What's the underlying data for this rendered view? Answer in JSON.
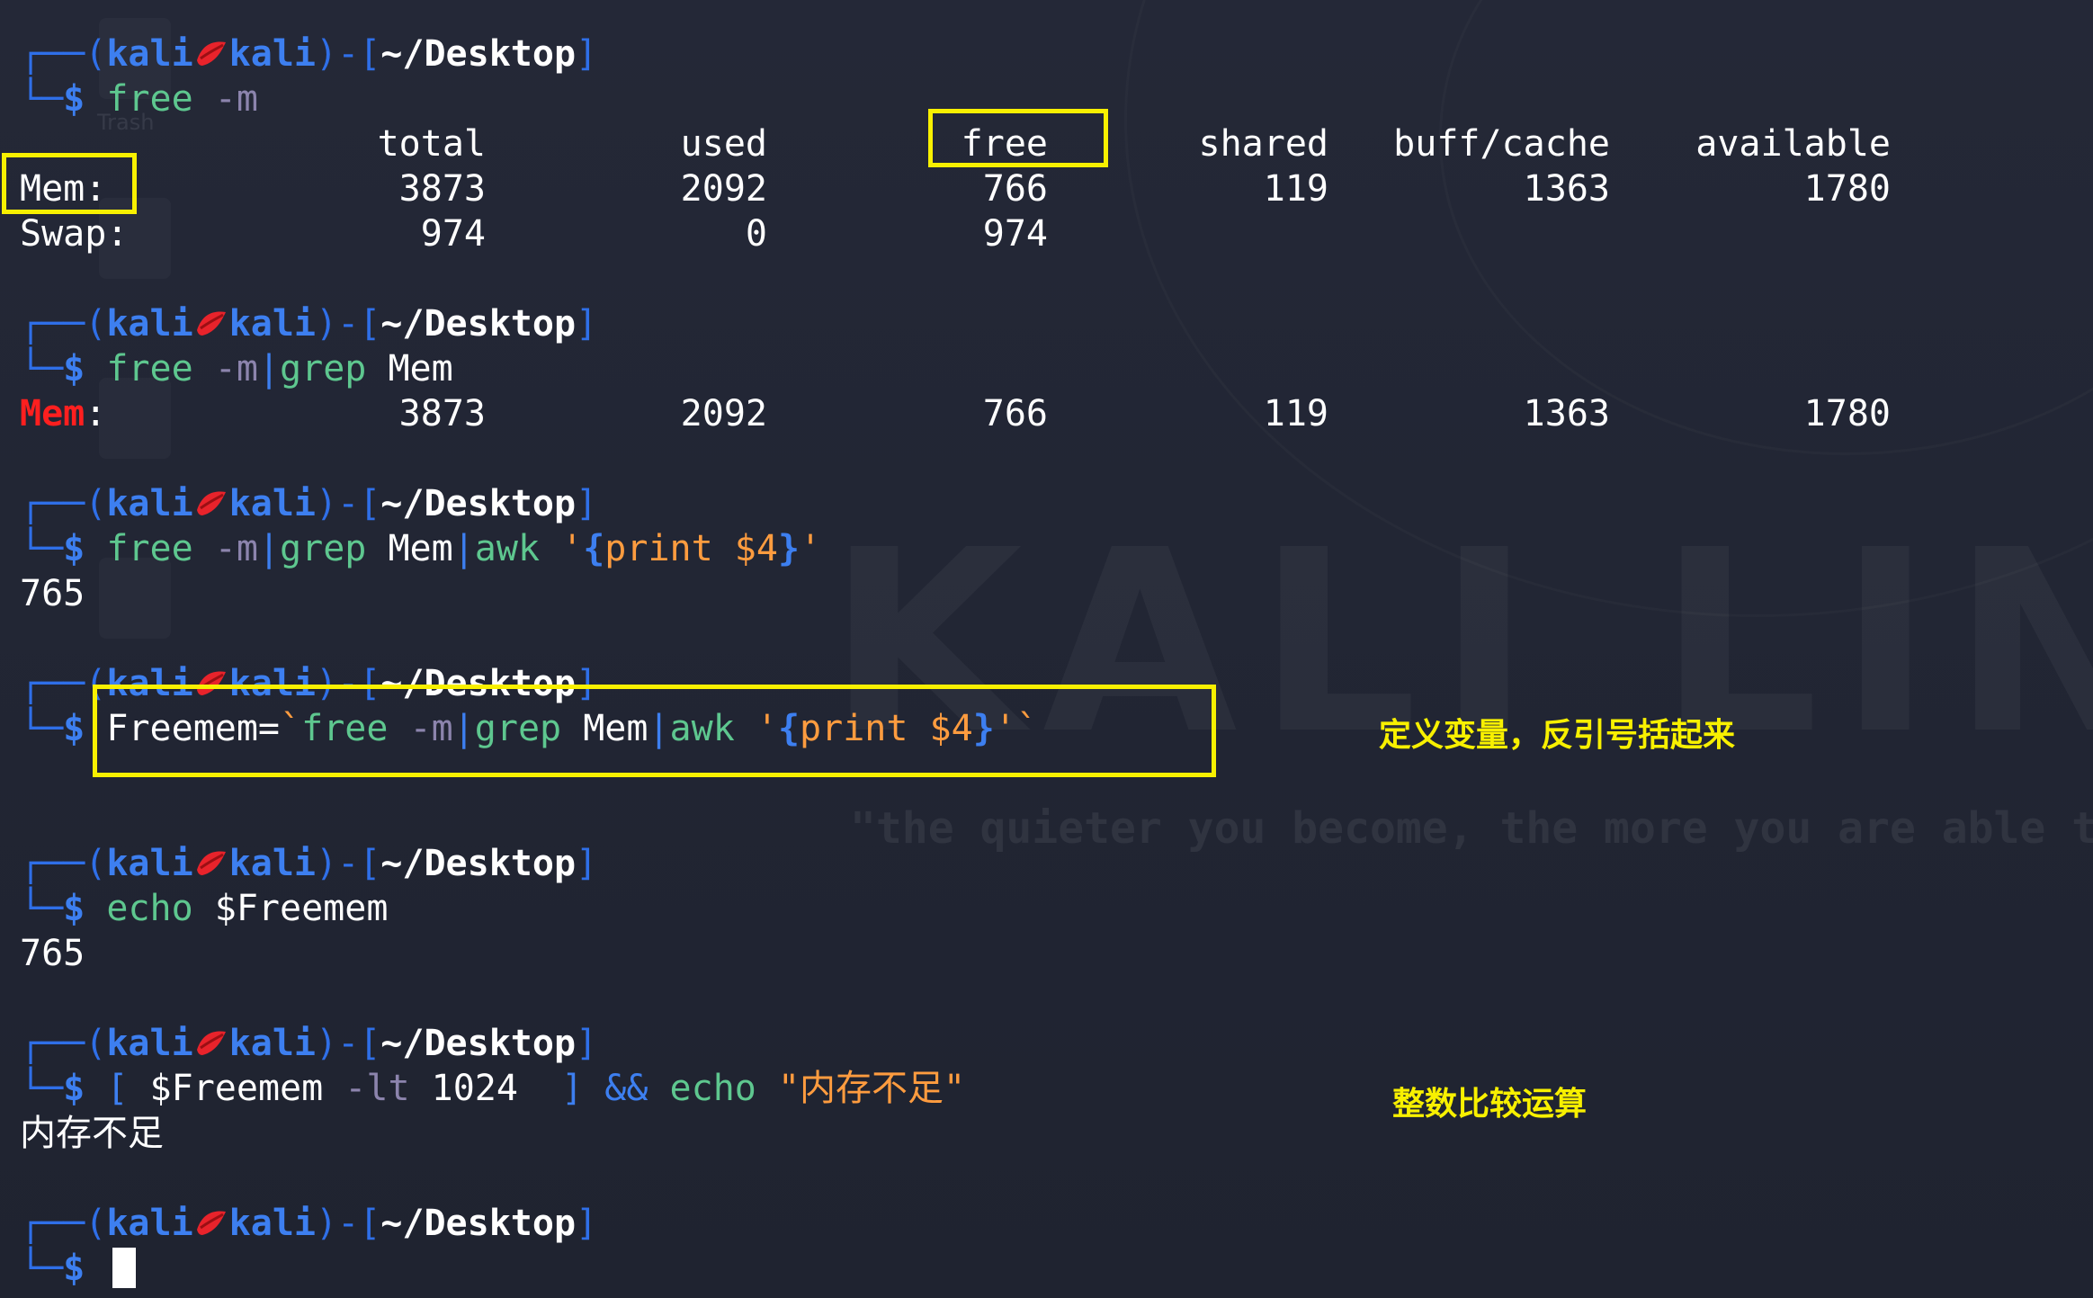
{
  "prompt": {
    "open_paren": "(",
    "user": "kali",
    "kiss_icon": "kiss-lips-icon",
    "host": "kali",
    "close_paren": ")",
    "dash": "-",
    "open_bracket": "[",
    "dir": "~/Desktop",
    "close_bracket": "]",
    "corner_top": "┌──",
    "corner_bottom": "└─",
    "dollar": "$"
  },
  "blocks": [
    {
      "command_parts": [
        {
          "text": "free",
          "type": "cmd"
        },
        {
          "text": " -m",
          "type": "opt"
        }
      ],
      "output_table": {
        "headers": [
          "total",
          "used",
          "free",
          "shared",
          "buff/cache",
          "available"
        ],
        "rows": [
          {
            "label": "Mem:",
            "values": [
              "3873",
              "2092",
              "766",
              "119",
              "1363",
              "1780"
            ]
          },
          {
            "label": "Swap:",
            "values": [
              "974",
              "0",
              "974",
              "",
              "",
              ""
            ]
          }
        ]
      }
    },
    {
      "command_parts": [
        {
          "text": "free",
          "type": "cmd"
        },
        {
          "text": " -m",
          "type": "opt"
        },
        {
          "text": "|",
          "type": "pipe"
        },
        {
          "text": "grep",
          "type": "cmd"
        },
        {
          "text": " Mem",
          "type": "plain"
        }
      ],
      "output_row": {
        "label_highlight": "Mem",
        "label_rest": ":",
        "values": [
          "3873",
          "2092",
          "766",
          "119",
          "1363",
          "1780"
        ]
      }
    },
    {
      "command_parts": [
        {
          "text": "free",
          "type": "cmd"
        },
        {
          "text": " -m",
          "type": "opt"
        },
        {
          "text": "|",
          "type": "pipe"
        },
        {
          "text": "grep",
          "type": "cmd"
        },
        {
          "text": " Mem",
          "type": "plain"
        },
        {
          "text": "|",
          "type": "pipe"
        },
        {
          "text": "awk",
          "type": "cmd"
        },
        {
          "text": " '",
          "type": "str"
        },
        {
          "text": "{",
          "type": "brace"
        },
        {
          "text": "print $4",
          "type": "str"
        },
        {
          "text": "}",
          "type": "brace"
        },
        {
          "text": "'",
          "type": "str"
        }
      ],
      "output": "765"
    },
    {
      "command_parts": [
        {
          "text": "Freemem=",
          "type": "plain"
        },
        {
          "text": "`",
          "type": "str"
        },
        {
          "text": "free",
          "type": "cmd"
        },
        {
          "text": " -m",
          "type": "opt"
        },
        {
          "text": "|",
          "type": "pipe"
        },
        {
          "text": "grep",
          "type": "cmd"
        },
        {
          "text": " Mem",
          "type": "plain"
        },
        {
          "text": "|",
          "type": "pipe"
        },
        {
          "text": "awk",
          "type": "cmd"
        },
        {
          "text": " '",
          "type": "str"
        },
        {
          "text": "{",
          "type": "brace"
        },
        {
          "text": "print $4",
          "type": "str"
        },
        {
          "text": "}",
          "type": "brace"
        },
        {
          "text": "'`",
          "type": "str"
        }
      ],
      "output": ""
    },
    {
      "command_parts": [
        {
          "text": "echo",
          "type": "cmd"
        },
        {
          "text": " $Freemem",
          "type": "plain"
        }
      ],
      "output": "765"
    },
    {
      "command_parts": [
        {
          "text": "[",
          "type": "pipe"
        },
        {
          "text": " $Freemem ",
          "type": "plain"
        },
        {
          "text": "-lt",
          "type": "opt"
        },
        {
          "text": " 1024 ",
          "type": "plain"
        },
        {
          "text": " ]",
          "type": "pipe"
        },
        {
          "text": " &&",
          "type": "pipe"
        },
        {
          "text": " echo",
          "type": "cmd"
        },
        {
          "text": " \"内存不足\"",
          "type": "str"
        }
      ],
      "output": "内存不足"
    },
    {
      "command_parts": [],
      "output": ""
    }
  ],
  "annotations": {
    "note_backtick": "定义变量，反引号括起来",
    "note_compare": "整数比较运算"
  },
  "wallpaper": {
    "logo_text": "KALI LINU",
    "slogan": "\"the quieter you become, the more you are able to",
    "trash_label": "Trash"
  },
  "colors": {
    "background": "#222633",
    "prompt_blue": "#3d7ff0",
    "command_green": "#5ec78f",
    "option_purple": "#8c84ad",
    "string_orange": "#ff9c3f",
    "highlight_yellow": "#f8f000",
    "match_red": "#ff1f1f"
  }
}
